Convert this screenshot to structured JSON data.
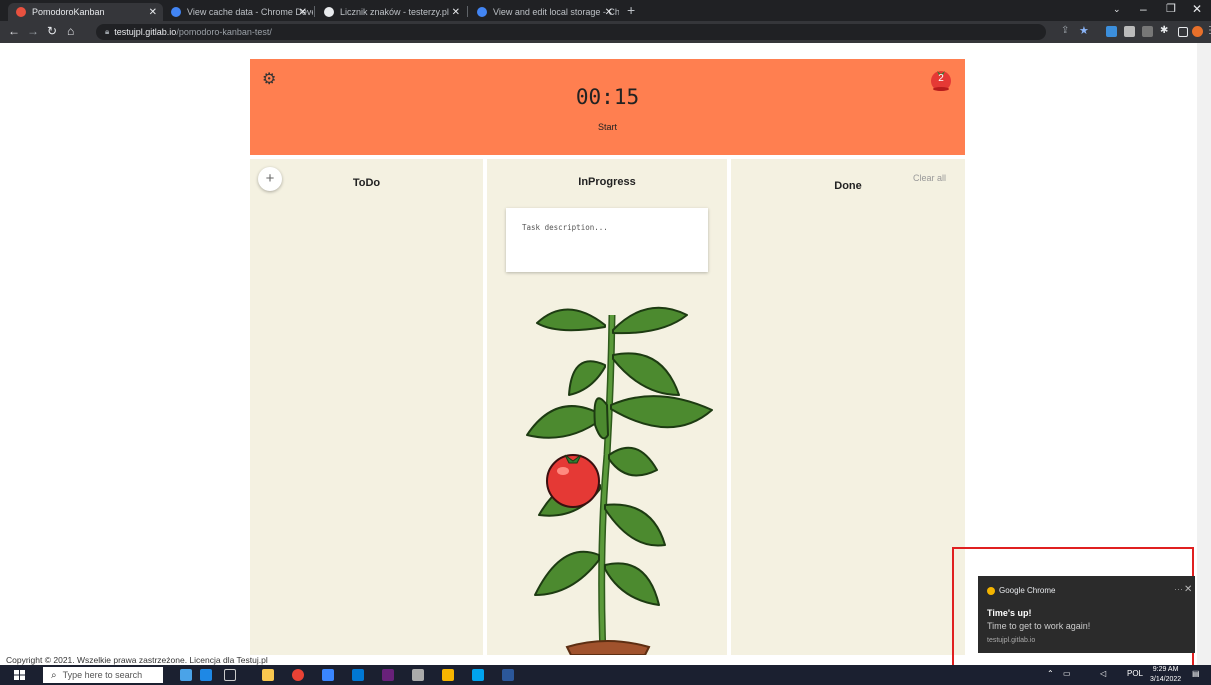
{
  "browser": {
    "tabs": [
      {
        "label": "PomodoroKanban",
        "active": true
      },
      {
        "label": "View cache data - Chrome Devel"
      },
      {
        "label": "Licznik znaków - testerzy.pl"
      },
      {
        "label": "View and edit local storage - Chr"
      }
    ],
    "new_tab": "+",
    "url_host": "testujpl.gitlab.io",
    "url_path": "/pomodoro-kanban-test/"
  },
  "header": {
    "timer": "00:15",
    "start_label": "Start",
    "tomato_count": "2",
    "color": "#ff7f50"
  },
  "columns": {
    "todo": {
      "title": "ToDo",
      "add_label": "+"
    },
    "inprogress": {
      "title": "InProgress",
      "task_placeholder": "Task description..."
    },
    "done": {
      "title": "Done",
      "clear_label": "Clear all"
    }
  },
  "footer": {
    "copyright": "Copyright © 2021. Wszelkie prawa zastrzeżone. Licencja dla Testuj.pl"
  },
  "notification": {
    "app": "Google Chrome",
    "title": "Time's up!",
    "body": "Time to get to work again!",
    "source": "testujpl.gitlab.io"
  },
  "taskbar": {
    "search_placeholder": "Type here to search",
    "time": "9:29 AM",
    "date": "3/14/2022",
    "lang": "POL"
  },
  "icons": [
    "gear-icon",
    "tomato-icon",
    "plus-icon",
    "tomato-plant-illustration",
    "chrome-icon",
    "search-icon",
    "windows-start-icon"
  ]
}
